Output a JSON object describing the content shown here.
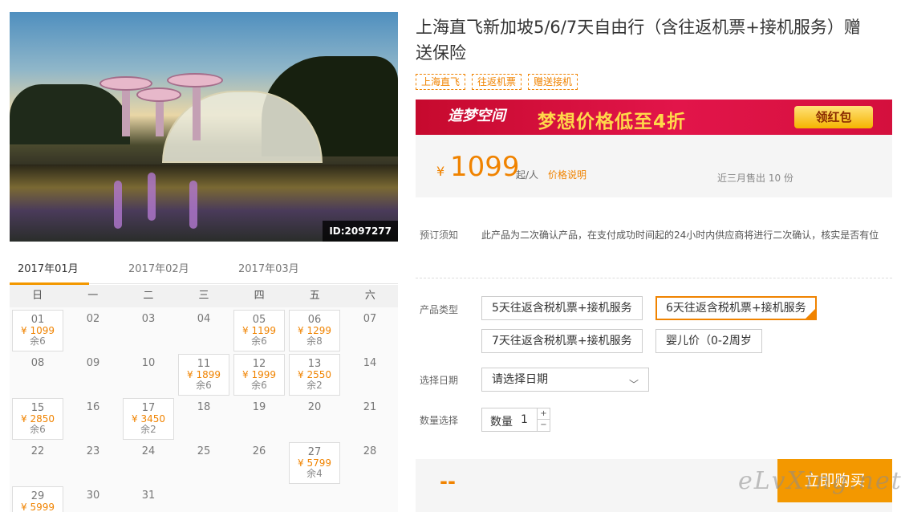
{
  "product": {
    "title": "上海直飞新加坡5/6/7天自由行（含往返机票+接机服务）赠送保险",
    "tags": [
      "上海直飞",
      "往返机票",
      "赠送接机"
    ],
    "image_id": "ID:2097277"
  },
  "banner": {
    "logo_text": "造梦空间",
    "slogan": "梦想价格低至4折",
    "cta": "领红包",
    "colors": {
      "background": "#d4103d",
      "slogan": "#ffd84a"
    }
  },
  "price": {
    "currency": "¥",
    "amount": "1099",
    "unit": "起/人",
    "explain_link": "价格说明",
    "sold": "近三月售出 10 份"
  },
  "calendar": {
    "months": [
      "2017年01月",
      "2017年02月",
      "2017年03月"
    ],
    "active_month": 0,
    "weekdays": [
      "日",
      "一",
      "二",
      "三",
      "四",
      "五",
      "六"
    ],
    "days": [
      {
        "d": "01",
        "price": "¥ 1099",
        "remain": "余6"
      },
      {
        "d": "02"
      },
      {
        "d": "03"
      },
      {
        "d": "04"
      },
      {
        "d": "05",
        "price": "¥ 1199",
        "remain": "余6"
      },
      {
        "d": "06",
        "price": "¥ 1299",
        "remain": "余8"
      },
      {
        "d": "07"
      },
      {
        "d": "08"
      },
      {
        "d": "09"
      },
      {
        "d": "10"
      },
      {
        "d": "11",
        "price": "¥ 1899",
        "remain": "余6"
      },
      {
        "d": "12",
        "price": "¥ 1999",
        "remain": "余6"
      },
      {
        "d": "13",
        "price": "¥ 2550",
        "remain": "余2"
      },
      {
        "d": "14"
      },
      {
        "d": "15",
        "price": "¥ 2850",
        "remain": "余6"
      },
      {
        "d": "16"
      },
      {
        "d": "17",
        "price": "¥ 3450",
        "remain": "余2"
      },
      {
        "d": "18"
      },
      {
        "d": "19"
      },
      {
        "d": "20"
      },
      {
        "d": "21"
      },
      {
        "d": "22"
      },
      {
        "d": "23"
      },
      {
        "d": "24"
      },
      {
        "d": "25"
      },
      {
        "d": "26"
      },
      {
        "d": "27",
        "price": "¥ 5799",
        "remain": "余4"
      },
      {
        "d": "28"
      },
      {
        "d": "29",
        "price": "¥ 5999",
        "remain": ""
      },
      {
        "d": "30"
      },
      {
        "d": "31"
      }
    ]
  },
  "booking": {
    "notice_label": "预订须知",
    "notice_text": "此产品为二次确认产品，在支付成功时间起的24小时内供应商将进行二次确认，核实是否有位",
    "type_label": "产品类型",
    "types": [
      "5天往返含税机票+接机服务",
      "6天往返含税机票+接机服务",
      "7天往返含税机票+接机服务",
      "婴儿价（0-2周岁"
    ],
    "selected_type": 1,
    "date_label": "选择日期",
    "date_placeholder": "请选择日期",
    "qty_label": "数量选择",
    "qty_field_label": "数量",
    "qty_value": "1",
    "total_placeholder": "--",
    "buy_button": "立即购买",
    "watermark": "eLvXing.net"
  }
}
